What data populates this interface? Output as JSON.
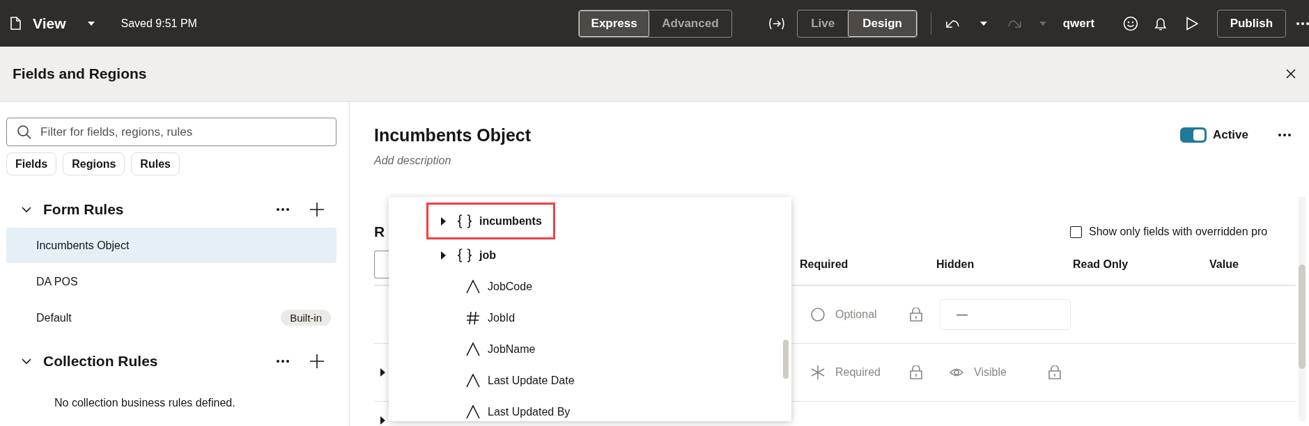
{
  "topbar": {
    "page_menu": {
      "label": "View"
    },
    "save_status": "Saved 9:51 PM",
    "edit_modes": [
      {
        "label": "Express",
        "selected": true
      },
      {
        "label": "Advanced",
        "selected": false
      }
    ],
    "view_modes": [
      {
        "label": "Live",
        "selected": false
      },
      {
        "label": "Design",
        "selected": true
      }
    ],
    "undo": {
      "disabled": false
    },
    "redo": {
      "disabled": true
    },
    "user": "qwert",
    "publish": "Publish"
  },
  "panel": {
    "title": "Fields and Regions"
  },
  "sidebar": {
    "filter": {
      "placeholder": "Filter for fields, regions, rules"
    },
    "chips": [
      "Fields",
      "Regions",
      "Rules"
    ],
    "sections": [
      {
        "title": "Form Rules",
        "expanded": true,
        "items": [
          {
            "label": "Incumbents Object",
            "selected": true
          },
          {
            "label": "DA POS",
            "selected": false
          },
          {
            "label": "Default",
            "selected": false,
            "badge": "Built-in"
          }
        ]
      },
      {
        "title": "Collection Rules",
        "expanded": true,
        "empty_text": "No collection business rules defined."
      }
    ]
  },
  "detail": {
    "title": "Incumbents Object",
    "description_placeholder": "Add description",
    "active": {
      "label": "Active",
      "on": true
    },
    "section_heading": "R",
    "overridden_filter": {
      "label": "Show only fields with overridden pro",
      "checked": false
    },
    "table": {
      "columns": [
        "Required",
        "Hidden",
        "Read Only",
        "Value"
      ],
      "rows": [
        {
          "cells": [
            {
              "kind": "optional",
              "label": "Optional",
              "locked": true
            },
            {
              "kind": "value",
              "value": "—"
            }
          ]
        },
        {
          "expanded": false,
          "cells": [
            {
              "kind": "required",
              "label": "Required",
              "locked": true
            },
            {
              "kind": "visible",
              "label": "Visible",
              "locked": true
            }
          ]
        },
        {
          "expanded": false,
          "cells": []
        }
      ]
    }
  },
  "field_picker": {
    "items": [
      {
        "label": "incumbents",
        "kind": "object",
        "expanded": false,
        "highlighted": true
      },
      {
        "label": "job",
        "kind": "object",
        "expanded": false,
        "highlighted": false
      },
      {
        "label": "JobCode",
        "kind": "text",
        "highlighted": false
      },
      {
        "label": "JobId",
        "kind": "number",
        "highlighted": false
      },
      {
        "label": "JobName",
        "kind": "text",
        "highlighted": false
      },
      {
        "label": "Last Update Date",
        "kind": "text",
        "highlighted": false
      },
      {
        "label": "Last Updated By",
        "kind": "text",
        "highlighted": false
      }
    ]
  }
}
